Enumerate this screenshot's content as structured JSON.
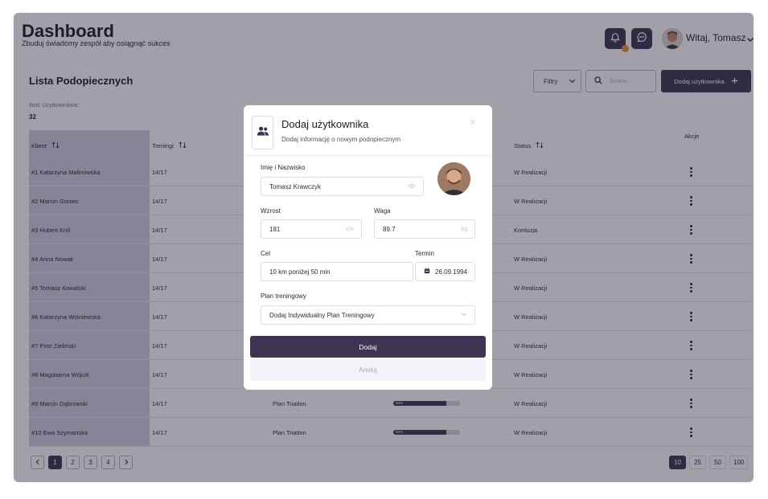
{
  "header": {
    "title": "Dashboard",
    "subtitle": "Zbuduj świadomy zespół aby osiągnąć sukces",
    "greeting": "Witaj, Tomasz"
  },
  "list": {
    "title": "Lista Podopiecznych",
    "filters_label": "Filtry",
    "search_placeholder": "Szukaj...",
    "add_button_label": "Dodaj użytkownika",
    "count_label": "Ilość Użytkowników:",
    "count_value": "32",
    "columns": {
      "client": "Klient",
      "trainings": "Treningi",
      "status": "Status",
      "actions": "Akcje"
    },
    "rows": [
      {
        "client": "#1 Katarzyna Malinowska",
        "trainings": "14/17",
        "plan": "",
        "progress": "",
        "progress_value": 0,
        "status": "W Realizacji"
      },
      {
        "client": "#2 Marcin Goniec",
        "trainings": "14/17",
        "plan": "",
        "progress": "",
        "progress_value": 0,
        "status": "W Realizacji"
      },
      {
        "client": "#3 Hubert Król",
        "trainings": "14/17",
        "plan": "",
        "progress": "",
        "progress_value": 0,
        "status": "Kontuzja"
      },
      {
        "client": "#4 Anna Nowak",
        "trainings": "14/17",
        "plan": "",
        "progress": "",
        "progress_value": 0,
        "status": "W Realizacji"
      },
      {
        "client": "#5 Tomasz Kowalski",
        "trainings": "14/17",
        "plan": "",
        "progress": "",
        "progress_value": 0,
        "status": "W Realizacji"
      },
      {
        "client": "#6 Katarzyna Wiśniewska",
        "trainings": "14/17",
        "plan": "",
        "progress": "",
        "progress_value": 0,
        "status": "W Realizacji"
      },
      {
        "client": "#7 Piotr Zieliński",
        "trainings": "14/17",
        "plan": "",
        "progress": "",
        "progress_value": 0,
        "status": "W Realizacji"
      },
      {
        "client": "#8 Magdalena Wójcik",
        "trainings": "14/17",
        "plan": "",
        "progress": "",
        "progress_value": 0,
        "status": "W Realizacji"
      },
      {
        "client": "#9 Marcin Dąbrowski",
        "trainings": "14/17",
        "plan": "Plan Triatlon",
        "progress": "80%",
        "progress_value": 80,
        "status": "W Realizacji"
      },
      {
        "client": "#10 Ewa Szymańska",
        "trainings": "14/17",
        "plan": "Plan Triatlon",
        "progress": "80%",
        "progress_value": 80,
        "status": "W Realizacji"
      }
    ]
  },
  "pagination": {
    "pages": [
      "1",
      "2",
      "3",
      "4"
    ],
    "per_page": [
      "10",
      "25",
      "50",
      "100"
    ]
  },
  "modal": {
    "title": "Dodaj użytkownika",
    "subtitle": "Dodaj informację o nowym podopiecznym",
    "name_label": "Imię i Nazwisko",
    "name_value": "Tomasz Krawczyk",
    "height_label": "Wzrost",
    "height_value": "181",
    "height_unit": "cm",
    "weight_label": "Waga",
    "weight_value": "89.7",
    "weight_unit": "kg",
    "goal_label": "Cel",
    "goal_value": "10 km poniżej 50 min",
    "deadline_label": "Termin",
    "deadline_value": "26.09.1994",
    "plan_label": "Plan treningowy",
    "plan_value": "Dodaj Indywidualny Plan Treningowy",
    "submit_label": "Dodaj",
    "cancel_label": "Anuluj"
  },
  "colors": {
    "primary": "#3f3452",
    "notification": "#e8962e",
    "overlay": "#1f1c30"
  }
}
